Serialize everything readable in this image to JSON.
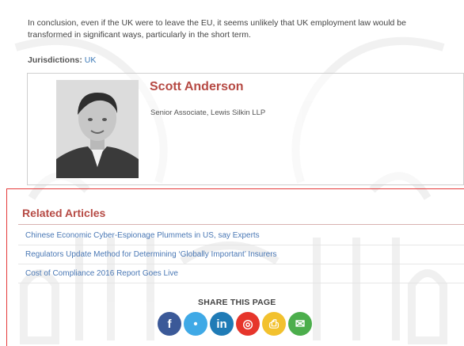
{
  "article": {
    "conclusion": "In conclusion, even if the UK were to leave the EU, it seems unlikely that UK employment law would be transformed in significant ways, particularly in the short term.",
    "jurisdictions_label": "Jurisdictions:",
    "jurisdictions_value": "UK"
  },
  "author": {
    "name": "Scott Anderson",
    "title": "Senior Associate, Lewis Silkin LLP"
  },
  "related": {
    "heading": "Related Articles",
    "items": [
      "Chinese Economic Cyber-Espionage Plummets in US, say Experts",
      "Regulators Update Method for Determining ‘Globally Important’ Insurers",
      "Cost of Compliance 2016 Report Goes Live"
    ]
  },
  "share": {
    "heading": "SHARE THIS PAGE",
    "buttons": [
      {
        "icon": "facebook-icon",
        "glyph": "f",
        "color": "#3b5998"
      },
      {
        "icon": "twitter-icon",
        "glyph": "•",
        "color": "#3fa9e6"
      },
      {
        "icon": "linkedin-icon",
        "glyph": "in",
        "color": "#1f7bb6"
      },
      {
        "icon": "weibo-icon",
        "glyph": "◎",
        "color": "#e6352b"
      },
      {
        "icon": "print-icon",
        "glyph": "⎙",
        "color": "#f2c12e"
      },
      {
        "icon": "email-icon",
        "glyph": "✉",
        "color": "#4cae4c"
      }
    ]
  },
  "colors": {
    "accent_red": "#b64a44",
    "link_blue": "#4a78b5",
    "highlight_border": "#e53a3a"
  }
}
